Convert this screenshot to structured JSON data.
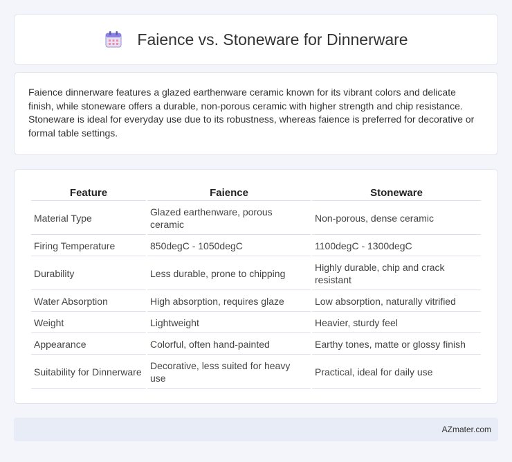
{
  "header": {
    "title": "Faience vs. Stoneware for Dinnerware",
    "icon": "calendar-icon"
  },
  "intro": {
    "text": "Faience dinnerware features a glazed earthenware ceramic known for its vibrant colors and delicate finish, while stoneware offers a durable, non-porous ceramic with higher strength and chip resistance. Stoneware is ideal for everyday use due to its robustness, whereas faience is preferred for decorative or formal table settings."
  },
  "table": {
    "headers": [
      "Feature",
      "Faience",
      "Stoneware"
    ],
    "rows": [
      [
        "Material Type",
        "Glazed earthenware, porous ceramic",
        "Non-porous, dense ceramic"
      ],
      [
        "Firing Temperature",
        "850degC - 1050degC",
        "1100degC - 1300degC"
      ],
      [
        "Durability",
        "Less durable, prone to chipping",
        "Highly durable, chip and crack resistant"
      ],
      [
        "Water Absorption",
        "High absorption, requires glaze",
        "Low absorption, naturally vitrified"
      ],
      [
        "Weight",
        "Lightweight",
        "Heavier, sturdy feel"
      ],
      [
        "Appearance",
        "Colorful, often hand-painted",
        "Earthy tones, matte or glossy finish"
      ],
      [
        "Suitability for Dinnerware",
        "Decorative, less suited for heavy use",
        "Practical, ideal for daily use"
      ]
    ]
  },
  "footer": {
    "brand": "AZmater.com"
  }
}
